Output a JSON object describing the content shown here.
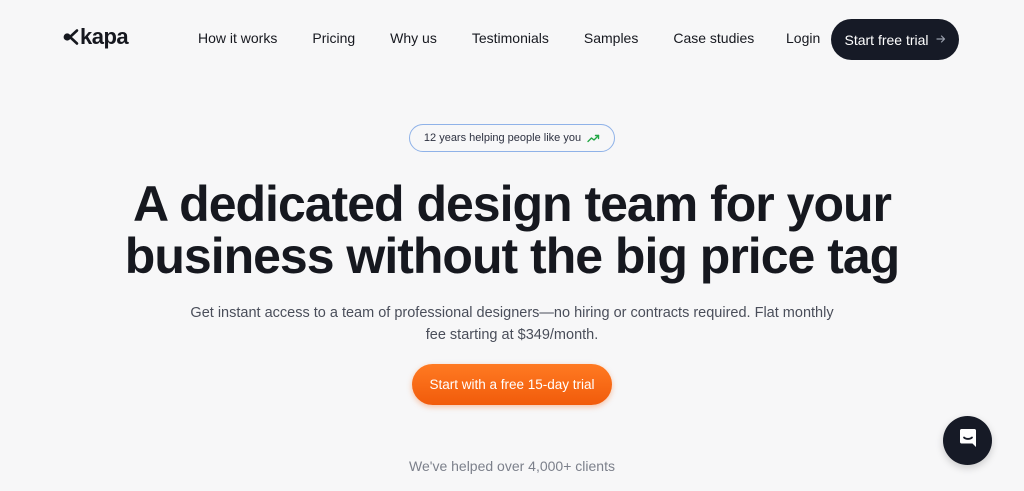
{
  "nav": {
    "logo_text": "kapa",
    "logo_icon": "kapa-logo-mark-icon",
    "links": [
      {
        "label": "How it works"
      },
      {
        "label": "Pricing"
      },
      {
        "label": "Why us"
      },
      {
        "label": "Testimonials"
      },
      {
        "label": "Samples"
      },
      {
        "label": "Case studies"
      }
    ],
    "login_label": "Login",
    "cta_label": "Start free trial",
    "cta_icon": "arrow-right-icon"
  },
  "hero": {
    "badge_text": "12 years helping people like you",
    "badge_icon": "trending-up-icon",
    "headline_line1": "A dedicated design team for your",
    "headline_line2": "business without the big price tag",
    "sub_line1": "Get instant access to a team of professional designers—no hiring or contracts required. Flat monthly",
    "sub_line2": "fee starting at $349/month.",
    "cta_label": "Start with a free 15-day trial",
    "helped_text": "We've helped over 4,000+ clients"
  },
  "chat": {
    "icon": "chat-bubble-icon"
  },
  "colors": {
    "background": "#f7f7f8",
    "dark": "#161a26",
    "accent_orange": "#f26a12",
    "badge_border": "#8fb2e8",
    "trend_green": "#22a745"
  }
}
